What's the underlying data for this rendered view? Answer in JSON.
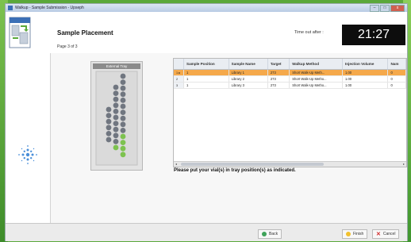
{
  "window": {
    "title": "Walkup - Sample Submission - Upseph",
    "minimize_glyph": "–",
    "maximize_glyph": "□",
    "close_glyph": "x"
  },
  "header": {
    "title": "Sample Placement",
    "page_info": "Page 3 of 3",
    "timeout_label": "Time out after :",
    "timer": "21:27"
  },
  "tray": {
    "title": "External Tray"
  },
  "table": {
    "columns": [
      "Sample Position",
      "Sample Name",
      "Target",
      "Walkup Method",
      "Injection Volume",
      "Nam"
    ],
    "rows": [
      {
        "num": "1",
        "marker": "▸",
        "position": "1",
        "name": "Library 1",
        "target": "273",
        "method": "Short Walk-Up Meth...",
        "volume": "1.00",
        "extra": "0",
        "selected": true
      },
      {
        "num": "2",
        "marker": "",
        "position": "1",
        "name": "Library 2",
        "target": "273",
        "method": "Short Walk-Up Metho...",
        "volume": "1.00",
        "extra": "0",
        "selected": false
      },
      {
        "num": "3",
        "marker": "",
        "position": "1",
        "name": "Library 3",
        "target": "273",
        "method": "Short Walk-Up Metho...",
        "volume": "1.00",
        "extra": "0",
        "selected": false
      }
    ]
  },
  "instruction": "Please put your vial(s) in tray position(s) as indicated.",
  "footer": {
    "back_label": "Back",
    "finish_label": "Finish",
    "cancel_label": "Cancel"
  },
  "colors": {
    "selected_row": "#f5a94b",
    "vial_green": "#7dc24f",
    "vial_gray": "#707680",
    "timer_bg": "#0d0d0d"
  }
}
